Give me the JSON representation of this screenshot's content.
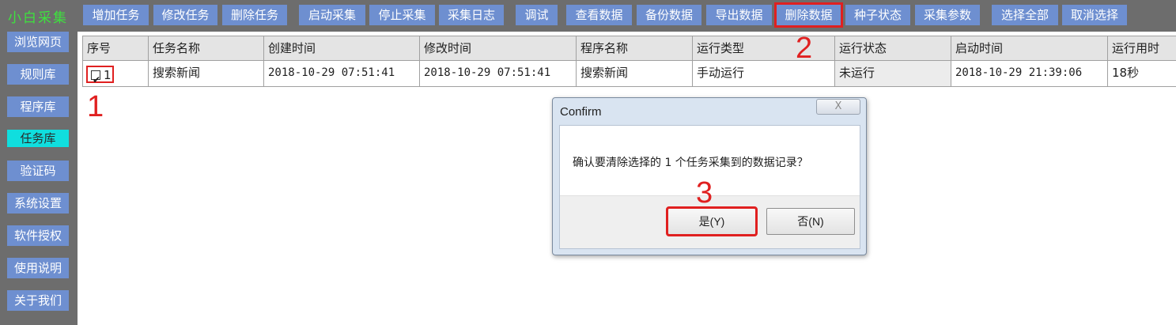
{
  "app": {
    "logo": "小白采集"
  },
  "toolbar": [
    {
      "label": "增加任务",
      "highlighted": false
    },
    {
      "label": "修改任务",
      "highlighted": false
    },
    {
      "label": "删除任务",
      "highlighted": false
    },
    {
      "label": "启动采集",
      "highlighted": false
    },
    {
      "label": "停止采集",
      "highlighted": false
    },
    {
      "label": "采集日志",
      "highlighted": false
    },
    {
      "label": "调试",
      "highlighted": false
    },
    {
      "label": "查看数据",
      "highlighted": false
    },
    {
      "label": "备份数据",
      "highlighted": false
    },
    {
      "label": "导出数据",
      "highlighted": false
    },
    {
      "label": "删除数据",
      "highlighted": true
    },
    {
      "label": "种子状态",
      "highlighted": false
    },
    {
      "label": "采集参数",
      "highlighted": false
    },
    {
      "label": "选择全部",
      "highlighted": false
    },
    {
      "label": "取消选择",
      "highlighted": false
    }
  ],
  "sidebar": [
    {
      "label": "浏览网页",
      "active": false
    },
    {
      "label": "规则库",
      "active": false
    },
    {
      "label": "程序库",
      "active": false
    },
    {
      "label": "任务库",
      "active": true
    },
    {
      "label": "验证码",
      "active": false
    },
    {
      "label": "系统设置",
      "active": false
    },
    {
      "label": "软件授权",
      "active": false
    },
    {
      "label": "使用说明",
      "active": false
    },
    {
      "label": "关于我们",
      "active": false
    }
  ],
  "table": {
    "columns": [
      "序号",
      "任务名称",
      "创建时间",
      "修改时间",
      "程序名称",
      "运行类型",
      "运行状态",
      "启动时间",
      "运行用时"
    ],
    "rows": [
      {
        "checked": true,
        "cells": [
          "1",
          "搜索新闻",
          "2018-10-29 07:51:41",
          "2018-10-29 07:51:41",
          "搜索新闻",
          "手动运行",
          "未运行",
          "2018-10-29 21:39:06",
          "18秒"
        ]
      }
    ]
  },
  "annotations": {
    "step1": "1",
    "step2": "2",
    "step3": "3"
  },
  "dialog": {
    "title": "Confirm",
    "close_glyph": "X",
    "message": "确认要清除选择的 1 个任务采集到的数据记录？",
    "yes_label": "是(Y)",
    "no_label": "否(N)"
  },
  "colors": {
    "frame": "#6d6d6d",
    "button": "#6e8fd0",
    "active": "#10dede",
    "logo": "#3ee23e",
    "highlight": "#e02020"
  }
}
